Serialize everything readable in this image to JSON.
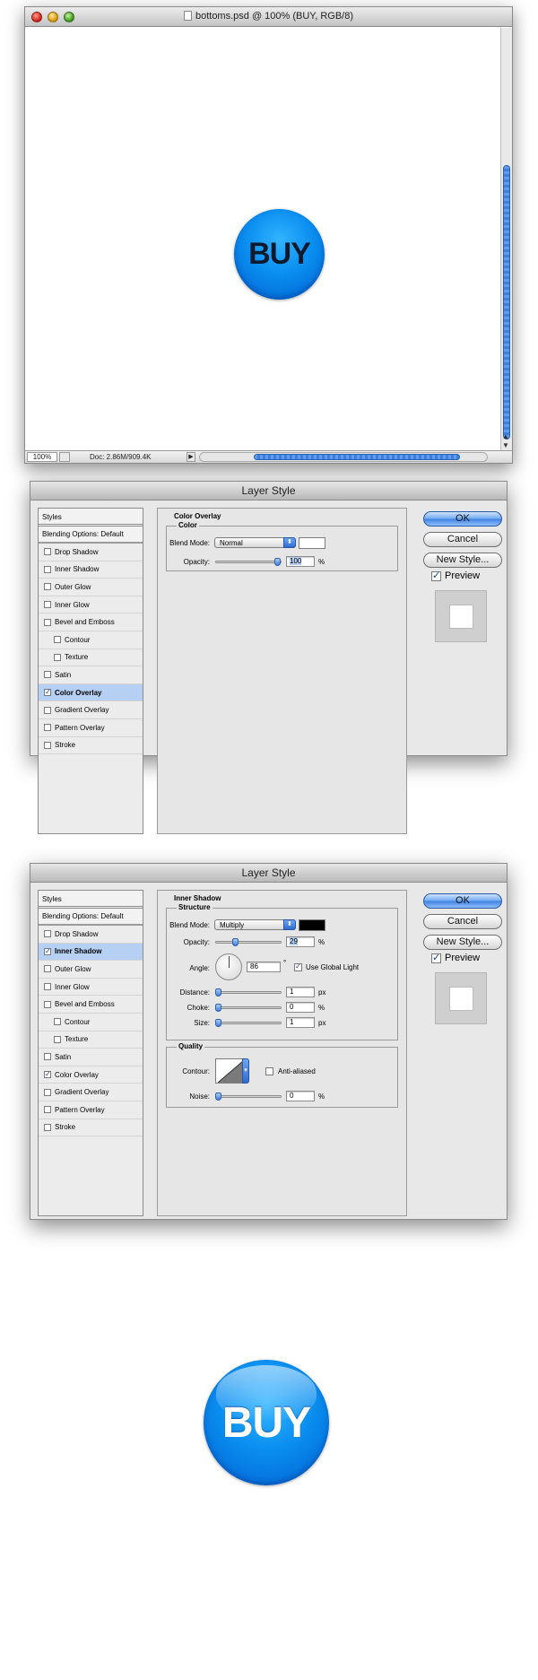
{
  "document": {
    "title": "bottoms.psd @ 100% (BUY, RGB/8)",
    "zoom": "100%",
    "doc_size": "Doc: 2.86M/909.4K",
    "button_text": "BUY"
  },
  "dialog1": {
    "title": "Layer Style",
    "styles_header": "Styles",
    "blending_options": "Blending Options: Default",
    "styles": [
      {
        "label": "Drop Shadow",
        "checked": false,
        "active": false,
        "sub": false
      },
      {
        "label": "Inner Shadow",
        "checked": false,
        "active": false,
        "sub": false
      },
      {
        "label": "Outer Glow",
        "checked": false,
        "active": false,
        "sub": false
      },
      {
        "label": "Inner Glow",
        "checked": false,
        "active": false,
        "sub": false
      },
      {
        "label": "Bevel and Emboss",
        "checked": false,
        "active": false,
        "sub": false
      },
      {
        "label": "Contour",
        "checked": false,
        "active": false,
        "sub": true
      },
      {
        "label": "Texture",
        "checked": false,
        "active": false,
        "sub": true
      },
      {
        "label": "Satin",
        "checked": false,
        "active": false,
        "sub": false
      },
      {
        "label": "Color Overlay",
        "checked": true,
        "active": true,
        "sub": false
      },
      {
        "label": "Gradient Overlay",
        "checked": false,
        "active": false,
        "sub": false
      },
      {
        "label": "Pattern Overlay",
        "checked": false,
        "active": false,
        "sub": false
      },
      {
        "label": "Stroke",
        "checked": false,
        "active": false,
        "sub": false
      }
    ],
    "panel_title": "Color Overlay",
    "group_title": "Color",
    "blend_mode_label": "Blend Mode:",
    "blend_mode_value": "Normal",
    "blend_color": "#ffffff",
    "opacity_label": "Opacity:",
    "opacity_value": "100",
    "opacity_percent": 100,
    "percent_unit": "%",
    "buttons": {
      "ok": "OK",
      "cancel": "Cancel",
      "new_style": "New Style..."
    },
    "preview_label": "Preview",
    "preview_checked": true
  },
  "dialog2": {
    "title": "Layer Style",
    "styles_header": "Styles",
    "blending_options": "Blending Options: Default",
    "styles": [
      {
        "label": "Drop Shadow",
        "checked": false,
        "active": false,
        "sub": false
      },
      {
        "label": "Inner Shadow",
        "checked": true,
        "active": true,
        "sub": false
      },
      {
        "label": "Outer Glow",
        "checked": false,
        "active": false,
        "sub": false
      },
      {
        "label": "Inner Glow",
        "checked": false,
        "active": false,
        "sub": false
      },
      {
        "label": "Bevel and Emboss",
        "checked": false,
        "active": false,
        "sub": false
      },
      {
        "label": "Contour",
        "checked": false,
        "active": false,
        "sub": true
      },
      {
        "label": "Texture",
        "checked": false,
        "active": false,
        "sub": true
      },
      {
        "label": "Satin",
        "checked": false,
        "active": false,
        "sub": false
      },
      {
        "label": "Color Overlay",
        "checked": true,
        "active": false,
        "sub": false
      },
      {
        "label": "Gradient Overlay",
        "checked": false,
        "active": false,
        "sub": false
      },
      {
        "label": "Pattern Overlay",
        "checked": false,
        "active": false,
        "sub": false
      },
      {
        "label": "Stroke",
        "checked": false,
        "active": false,
        "sub": false
      }
    ],
    "panel_title": "Inner Shadow",
    "structure_title": "Structure",
    "blend_mode_label": "Blend Mode:",
    "blend_mode_value": "Multiply",
    "blend_color": "#000000",
    "opacity_label": "Opacity:",
    "opacity_value": "29",
    "opacity_percent": 29,
    "angle_label": "Angle:",
    "angle_value": "86",
    "degree_unit": "°",
    "global_light_label": "Use Global Light",
    "global_light_checked": true,
    "distance_label": "Distance:",
    "distance_value": "1",
    "choke_label": "Choke:",
    "choke_value": "0",
    "size_label": "Size:",
    "size_value": "1",
    "px_unit": "px",
    "percent_unit": "%",
    "quality_title": "Quality",
    "contour_label": "Contour:",
    "anti_aliased_label": "Anti-aliased",
    "anti_aliased_checked": false,
    "noise_label": "Noise:",
    "noise_value": "0",
    "buttons": {
      "ok": "OK",
      "cancel": "Cancel",
      "new_style": "New Style..."
    },
    "preview_label": "Preview",
    "preview_checked": true
  },
  "result": {
    "button_text": "BUY"
  },
  "colors": {
    "accent_blue": "#3d80e0",
    "button_blue": "#0a8ef0",
    "selection_blue": "#b6d0f4"
  }
}
